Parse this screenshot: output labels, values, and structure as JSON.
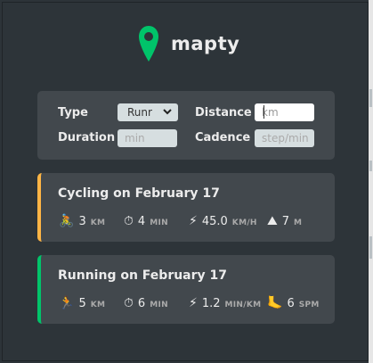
{
  "brand": {
    "name": "mapty",
    "accent": "#00c46a"
  },
  "form": {
    "type_label": "Type",
    "type_value": "Runr",
    "distance_label": "Distance",
    "distance_placeholder": "km",
    "duration_label": "Duration",
    "duration_placeholder": "min",
    "cadence_label": "Cadence",
    "cadence_placeholder": "step/min"
  },
  "workouts": [
    {
      "title": "Cycling on February 17",
      "color": "#ffb545",
      "stats": [
        {
          "icon": "🚴",
          "value": "3",
          "unit": "KM"
        },
        {
          "icon": "⏱",
          "value": "4",
          "unit": "MIN"
        },
        {
          "icon": "⚡",
          "value": "45.0",
          "unit": "KM/H"
        },
        {
          "icon": "⛰",
          "value": "7",
          "unit": "M"
        }
      ]
    },
    {
      "title": "Running on February 17",
      "color": "#00c46a",
      "stats": [
        {
          "icon": "🏃",
          "value": "5",
          "unit": "KM"
        },
        {
          "icon": "⏱",
          "value": "6",
          "unit": "MIN"
        },
        {
          "icon": "⚡",
          "value": "1.2",
          "unit": "MIN/KM"
        },
        {
          "icon": "🦶",
          "value": "6",
          "unit": "SPM"
        }
      ]
    }
  ]
}
